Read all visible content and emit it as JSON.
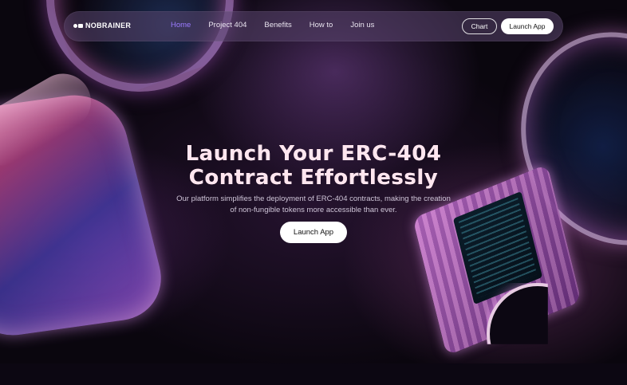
{
  "nav": {
    "logo_text": "NOBRAINER",
    "links": [
      "Home",
      "Project 404",
      "Benefits",
      "How to",
      "Join us"
    ],
    "active_link": "Home",
    "chart_label": "Chart",
    "launch_label": "Launch App"
  },
  "hero": {
    "title_line1": "Launch Your ERC-404",
    "title_line2": "Contract Effortlessly",
    "subtitle_line1": "Our platform simplifies the deployment of ERC-404 contracts, making the creation",
    "subtitle_line2": "of non-fungible tokens more accessible than ever.",
    "cta_label": "Launch App"
  },
  "colors": {
    "accent_active_link": "#9b7bff",
    "button_bg": "#ffffff",
    "background": "#0c0712"
  }
}
